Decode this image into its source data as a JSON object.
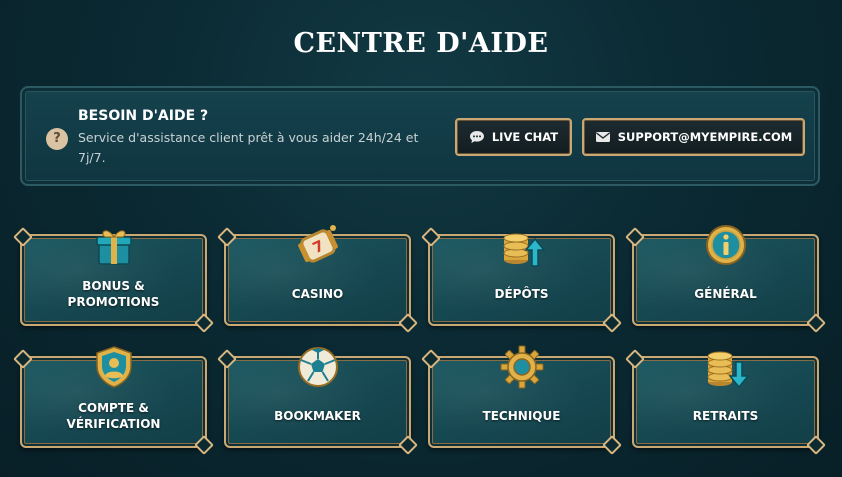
{
  "page": {
    "title": "CENTRE D'AIDE"
  },
  "help": {
    "title": "BESOIN D'AIDE ?",
    "description": "Service d'assistance client prêt à vous aider 24h/24 et 7j/7.",
    "icon": "question-icon",
    "live_chat_label": "LIVE CHAT",
    "email_label": "SUPPORT@MYEMPIRE.COM"
  },
  "categories": [
    {
      "label": "BONUS &\nPROMOTIONS",
      "icon": "gift-icon"
    },
    {
      "label": "CASINO",
      "icon": "slot-reel-icon"
    },
    {
      "label": "DÉPÔTS",
      "icon": "coins-deposit-icon"
    },
    {
      "label": "GÉNÉRAL",
      "icon": "info-icon"
    },
    {
      "label": "COMPTE &\nVÉRIFICATION",
      "icon": "shield-user-icon"
    },
    {
      "label": "BOOKMAKER",
      "icon": "soccer-ball-icon"
    },
    {
      "label": "TECHNIQUE",
      "icon": "gear-icon"
    },
    {
      "label": "RETRAITS",
      "icon": "coins-withdraw-icon"
    }
  ],
  "colors": {
    "accent_gold": "#c9a873",
    "card_teal": "#1d5a62",
    "background": "#0b2a33"
  }
}
